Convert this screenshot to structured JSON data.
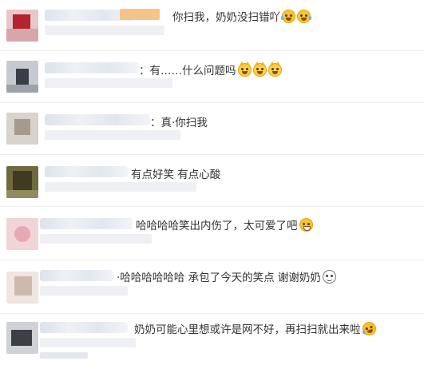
{
  "comments": [
    {
      "id": "c1",
      "text": "你扫我，奶奶没扫错吖",
      "emojis": [
        "laugh-cry",
        "laugh-cry"
      ]
    },
    {
      "id": "c2",
      "text": "：有……什么问题吗",
      "emojis": [
        "cat-face",
        "cat-face",
        "cat-face"
      ]
    },
    {
      "id": "c3",
      "text": "：真·你扫我",
      "emojis": []
    },
    {
      "id": "c4",
      "text": "有点好笑  有点心酸",
      "emojis": []
    },
    {
      "id": "c5",
      "text": "哈哈哈哈笑出内伤了，太可爱了吧",
      "emojis": [
        "grin"
      ]
    },
    {
      "id": "c6",
      "text": "·哈哈哈哈哈哈  承包了今天的笑点 谢谢奶奶",
      "emojis": [
        "sweat-smile"
      ]
    },
    {
      "id": "c7",
      "text": "奶奶可能心里想或许是网不好，再扫扫就出来啦",
      "emojis": [
        "laugh-cry-tilt"
      ]
    }
  ],
  "colors": {
    "text": "#333333",
    "divider": "#eeeeee",
    "emoji": "#f7c62f"
  }
}
